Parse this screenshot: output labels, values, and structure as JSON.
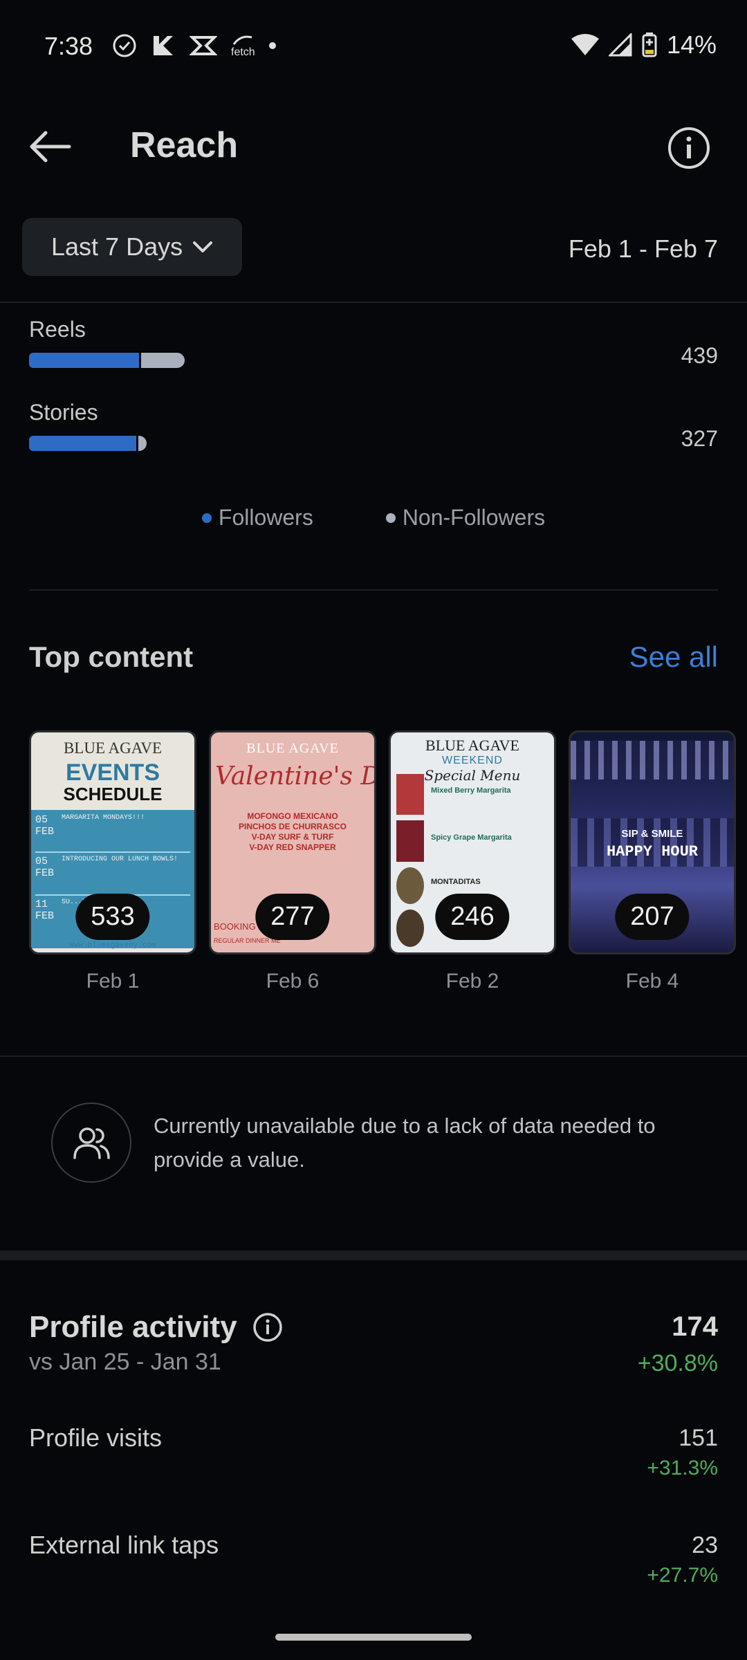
{
  "status": {
    "time": "7:38",
    "battery": "14%",
    "fetch_label": "fetch"
  },
  "header": {
    "title": "Reach"
  },
  "range": {
    "selector": "Last 7 Days",
    "dates": "Feb 1 - Feb 7"
  },
  "reach_breakdown": [
    {
      "label": "Reels",
      "value": "439",
      "followers_fraction": 0.71,
      "nonfollowers_fraction": 0.28
    },
    {
      "label": "Stories",
      "value": "327",
      "followers_fraction": 0.93,
      "nonfollowers_fraction": 0.07
    }
  ],
  "legend": {
    "followers": "Followers",
    "non_followers": "Non-Followers"
  },
  "colors": {
    "followers": "#2e6bc5",
    "non_followers": "#aab1bd",
    "accent": "#3c7fd9",
    "positive": "#4fae5b"
  },
  "top_content": {
    "title": "Top content",
    "see_all": "See all",
    "items": [
      {
        "count": "533",
        "date": "Feb 1",
        "brand": "BLUE AGAVE",
        "heading1": "EVENTS",
        "heading2": "SCHEDULE",
        "rows": [
          "MARGARITA MONDAYS!!!",
          "INTRODUCING OUR LUNCH BOWLS!",
          "SU...BEGINS!!!"
        ],
        "row_dates": [
          "05 FEB",
          "05 FEB",
          "11 FEB"
        ],
        "site": "www.blueagaveny.com"
      },
      {
        "count": "277",
        "date": "Feb 6",
        "brand": "BLUE AGAVE",
        "script": "Valentine's Day Me",
        "menu": [
          "MOFONGO MEXICANO",
          "PINCHOS DE CHURRASCO",
          "V-DAY SURF & TURF",
          "V-DAY RED SNAPPER"
        ],
        "footer1": "BOOKING N",
        "footer2": "REGULAR DINNER ME"
      },
      {
        "count": "246",
        "date": "Feb 2",
        "brand": "BLUE AGAVE",
        "sub": "WEEKEND",
        "script": "Special Menu",
        "items": [
          "Mixed Berry Margarita",
          "Spicy Grape Margarita",
          "MONTADITAS"
        ]
      },
      {
        "count": "207",
        "date": "Feb 4",
        "line1": "SIP & SMILE",
        "line2": "HAPPY HOUR"
      }
    ]
  },
  "unavailable_text": "Currently unavailable due to a lack of data needed to provide a value.",
  "profile_activity": {
    "title": "Profile activity",
    "comparison": "vs Jan 25 - Jan 31",
    "total": "174",
    "total_change": "+30.8%",
    "metrics": [
      {
        "label": "Profile visits",
        "value": "151",
        "change": "+31.3%"
      },
      {
        "label": "External link taps",
        "value": "23",
        "change": "+27.7%"
      }
    ]
  }
}
